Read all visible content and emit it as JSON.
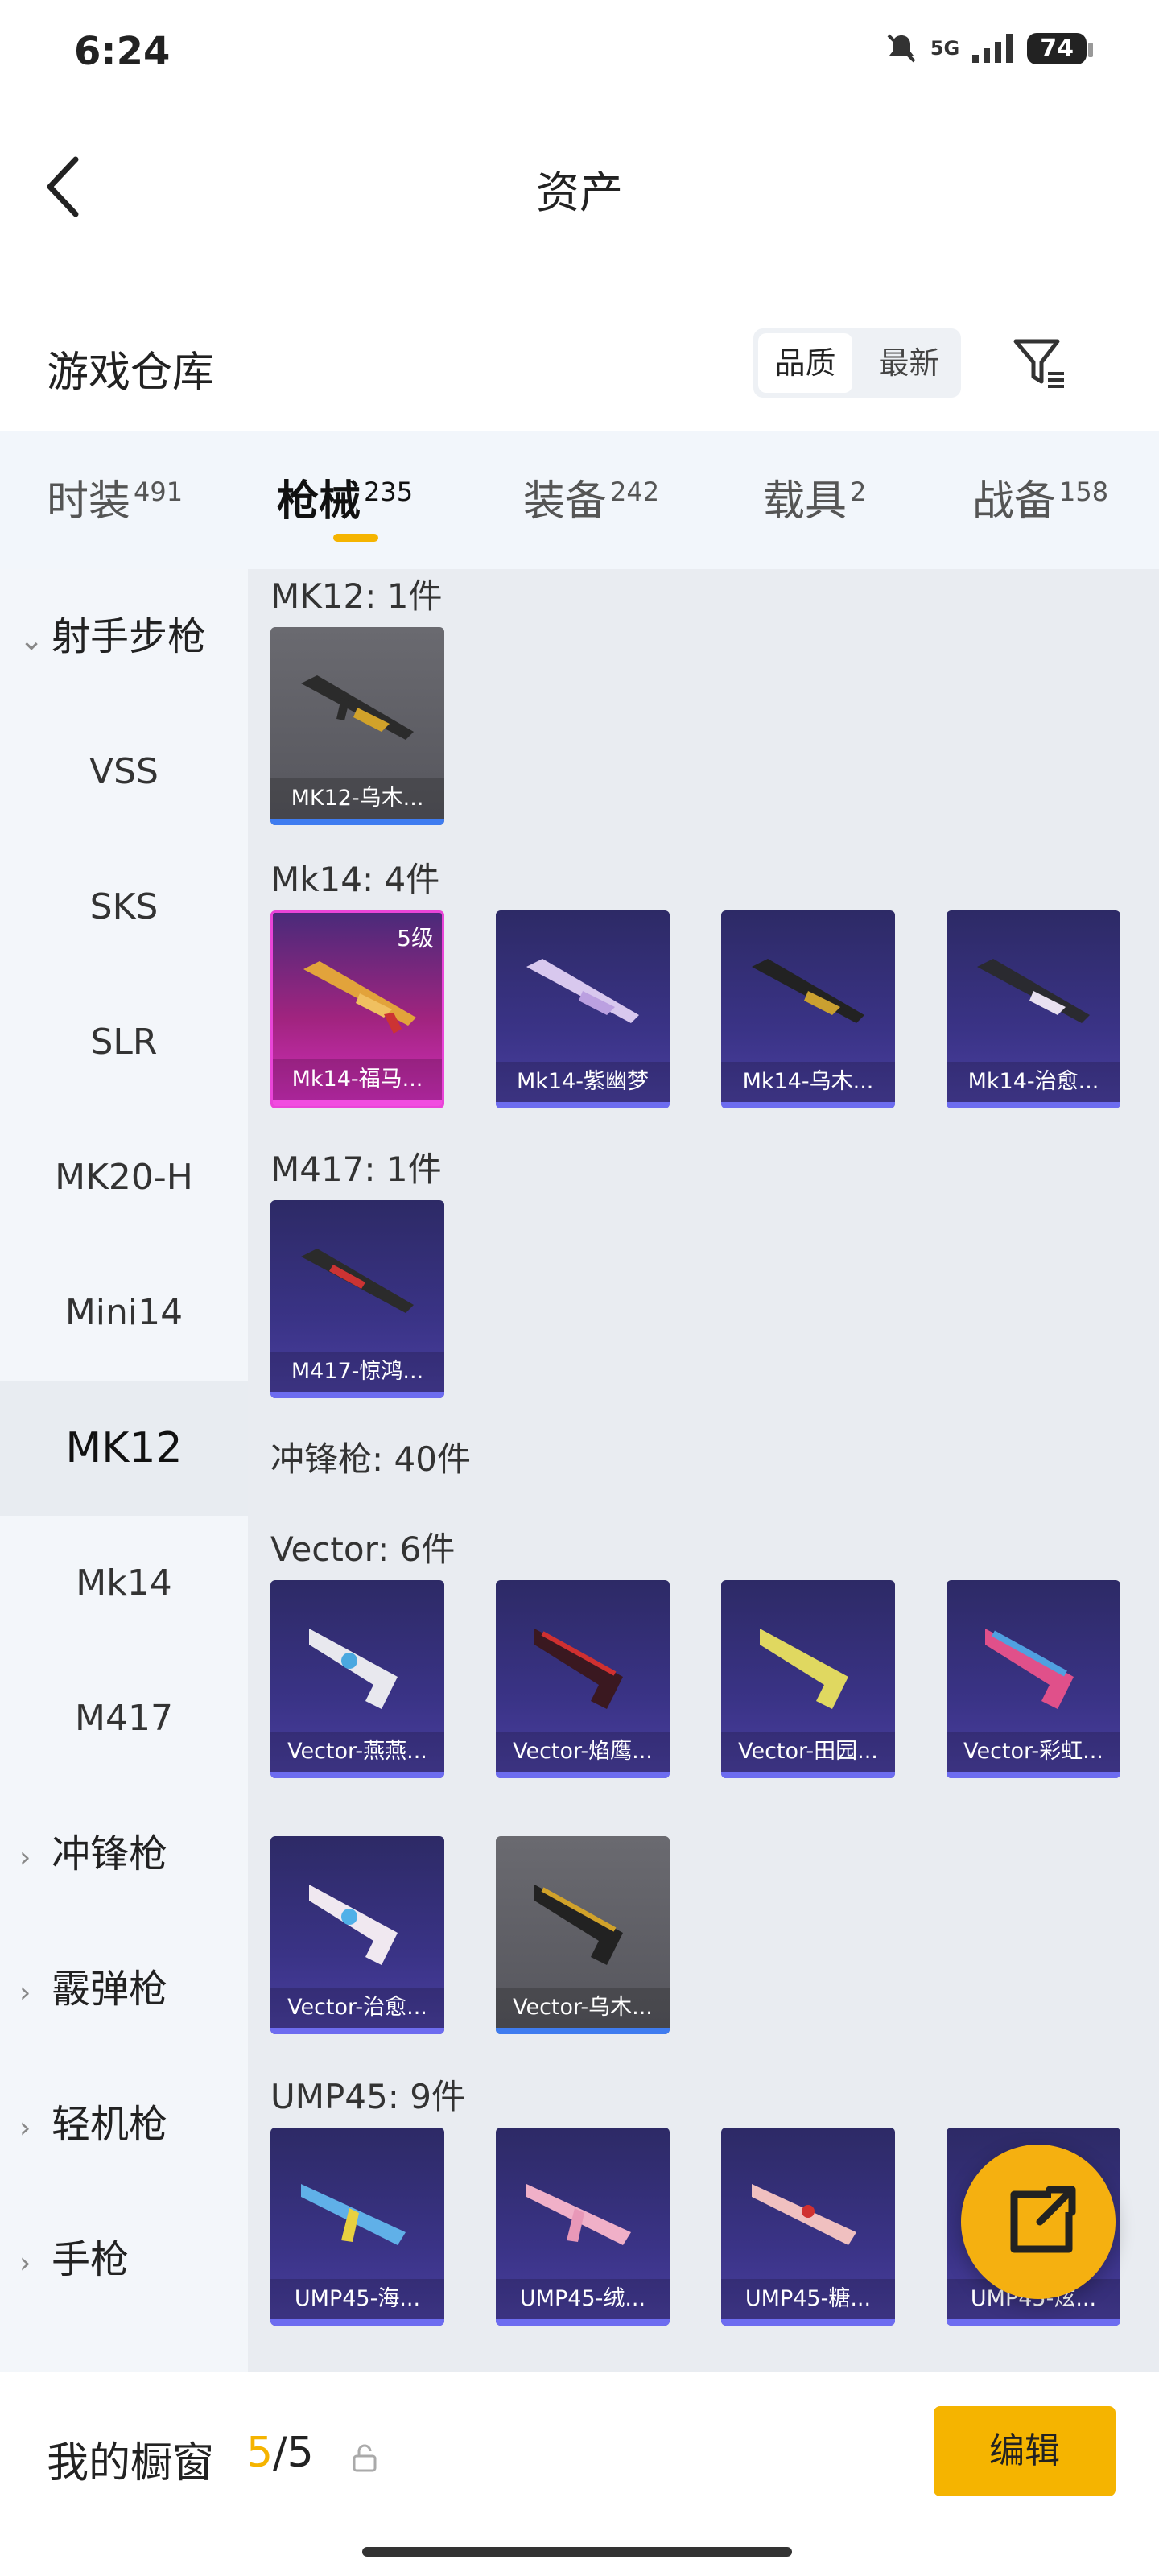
{
  "status": {
    "time": "6:24",
    "network": "5G",
    "battery": "74"
  },
  "header": {
    "title": "资产"
  },
  "section": {
    "title": "游戏仓库",
    "sort_quality": "品质",
    "sort_newest": "最新"
  },
  "tabs": [
    {
      "label": "时装",
      "count": "491"
    },
    {
      "label": "枪械",
      "count": "235"
    },
    {
      "label": "装备",
      "count": "242"
    },
    {
      "label": "载具",
      "count": "2"
    },
    {
      "label": "战备",
      "count": "158"
    }
  ],
  "sidebar": {
    "cat_marksman": "射手步枪",
    "items": [
      "VSS",
      "SKS",
      "SLR",
      "MK20-H",
      "Mini14",
      "MK12",
      "Mk14",
      "M417"
    ],
    "cat_smg": "冲锋枪",
    "cat_shotgun": "霰弹枪",
    "cat_lmg": "轻机枪",
    "cat_pistol": "手枪"
  },
  "groups": {
    "mk12": "MK12: 1件",
    "mk14": "Mk14: 4件",
    "m417": "M417: 1件",
    "smg": "冲锋枪: 40件",
    "vector": "Vector: 6件",
    "ump": "UMP45: 9件"
  },
  "cards": {
    "mk12_1": "MK12-乌木...",
    "mk14_1": "Mk14-福马...",
    "mk14_1_level": "5级",
    "mk14_2": "Mk14-紫幽梦",
    "mk14_3": "Mk14-乌木...",
    "mk14_4": "Mk14-治愈...",
    "m417_1": "M417-惊鸿...",
    "vec_1": "Vector-燕燕...",
    "vec_2": "Vector-焰鹰...",
    "vec_3": "Vector-田园...",
    "vec_4": "Vector-彩虹...",
    "vec_5": "Vector-治愈...",
    "vec_6": "Vector-乌木...",
    "ump_1": "UMP45-海...",
    "ump_2": "UMP45-绒...",
    "ump_3": "UMP45-糖...",
    "ump_4": "UMP45-炫..."
  },
  "footer": {
    "title": "我的橱窗",
    "count_current": "5",
    "count_total": "/5",
    "edit_label": "编辑"
  },
  "colors": {
    "accent": "#f5b400",
    "card_purple": "#3a3386",
    "card_gray": "#5a5a60",
    "card_pink": "#d32fbf"
  }
}
